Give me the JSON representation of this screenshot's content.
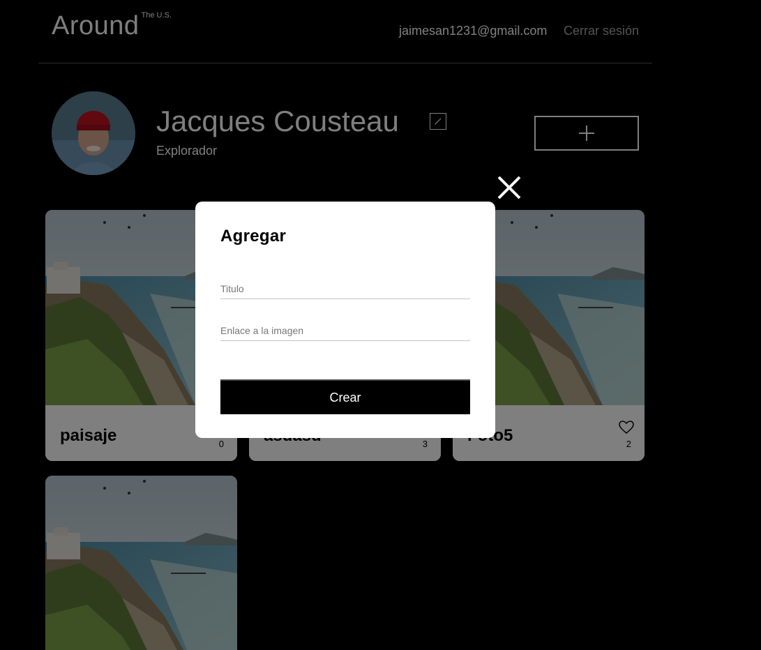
{
  "header": {
    "logo": "Around",
    "logo_sub": "The U.S.",
    "email": "jaimesan1231@gmail.com",
    "logout": "Cerrar sesión"
  },
  "profile": {
    "name": "Jacques Cousteau",
    "about": "Explorador",
    "add_icon": "plus-icon",
    "edit_icon": "pencil-icon"
  },
  "cards": [
    {
      "title": "paisaje",
      "likes": "0"
    },
    {
      "title": "asdasd",
      "likes": "3"
    },
    {
      "title": "Foto5",
      "likes": "2"
    },
    {
      "title": "",
      "likes": ""
    }
  ],
  "modal": {
    "title": "Agregar",
    "title_placeholder": "Titulo",
    "link_placeholder": "Enlace a la imagen",
    "submit": "Crear",
    "close_icon": "close-icon"
  },
  "colors": {
    "background": "#000000",
    "muted_text": "#a9a9a9",
    "card_bg": "#ffffff",
    "overlay": "rgba(0,0,0,0.5)"
  }
}
